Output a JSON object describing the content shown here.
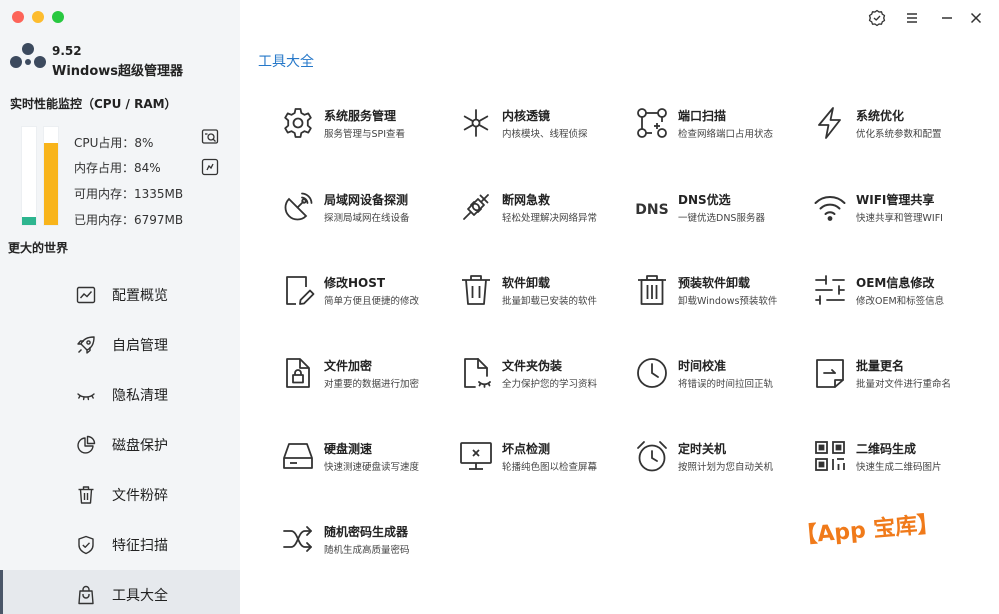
{
  "app": {
    "version": "9.52",
    "name": "Windows超级管理器",
    "slogan": "更大的世界"
  },
  "monitor": {
    "title": "实时性能监控（CPU / RAM）",
    "cpu_percent": 8,
    "mem_percent": 84,
    "stats": [
      "CPU占用：8%",
      "内存占用：84%",
      "可用内存：1335MB",
      "已用内存：6797MB"
    ],
    "colors": {
      "cpu": "#2db58f",
      "mem": "#f8b41b"
    }
  },
  "nav": [
    {
      "label": "配置概览",
      "icon": "chart-line-icon"
    },
    {
      "label": "自启管理",
      "icon": "rocket-icon"
    },
    {
      "label": "隐私清理",
      "icon": "eye-closed-icon"
    },
    {
      "label": "磁盘保护",
      "icon": "pie-chart-icon"
    },
    {
      "label": "文件粉碎",
      "icon": "trash-icon"
    },
    {
      "label": "特征扫描",
      "icon": "shield-check-icon"
    },
    {
      "label": "工具大全",
      "icon": "bag-icon",
      "active": true
    }
  ],
  "main": {
    "title": "工具大全",
    "accent": "#2678c9",
    "tools": [
      {
        "title": "系统服务管理",
        "desc": "服务管理与SPI查看",
        "icon": "gear-icon"
      },
      {
        "title": "内核透镜",
        "desc": "内核模块、线程侦探",
        "icon": "nodes-icon"
      },
      {
        "title": "端口扫描",
        "desc": "检查网络端口占用状态",
        "icon": "port-scan-icon"
      },
      {
        "title": "系统优化",
        "desc": "优化系统参数和配置",
        "icon": "lightning-icon"
      },
      {
        "title": "局域网设备探测",
        "desc": "探测局域网在线设备",
        "icon": "satellite-dish-icon"
      },
      {
        "title": "断网急救",
        "desc": "轻松处理解决网络异常",
        "icon": "plug-icon"
      },
      {
        "title": "DNS优选",
        "desc": "一键优选DNS服务器",
        "icon": "dns-icon",
        "icon_text": "DNS"
      },
      {
        "title": "WIFI管理共享",
        "desc": "快速共享和管理WIFI",
        "icon": "wifi-icon"
      },
      {
        "title": "修改HOST",
        "desc": "简单方便且便捷的修改",
        "icon": "file-edit-icon"
      },
      {
        "title": "软件卸载",
        "desc": "批量卸载已安装的软件",
        "icon": "trash-icon"
      },
      {
        "title": "预装软件卸载",
        "desc": "卸载Windows预装软件",
        "icon": "trash-box-icon"
      },
      {
        "title": "OEM信息修改",
        "desc": "修改OEM和标签信息",
        "icon": "sliders-icon"
      },
      {
        "title": "文件加密",
        "desc": "对重要的数据进行加密",
        "icon": "file-lock-icon"
      },
      {
        "title": "文件夹伪装",
        "desc": "全力保护您的学习资料",
        "icon": "file-disguise-icon"
      },
      {
        "title": "时间校准",
        "desc": "将错误的时间拉回正轨",
        "icon": "clock-icon"
      },
      {
        "title": "批量更名",
        "desc": "批量对文件进行重命名",
        "icon": "rename-icon"
      },
      {
        "title": "硬盘测速",
        "desc": "快速测速硬盘读写速度",
        "icon": "hard-drive-icon"
      },
      {
        "title": "坏点检测",
        "desc": "轮播纯色图以检查屏幕",
        "icon": "monitor-icon"
      },
      {
        "title": "定时关机",
        "desc": "按照计划为您自动关机",
        "icon": "alarm-clock-icon"
      },
      {
        "title": "二维码生成",
        "desc": "快速生成二维码图片",
        "icon": "qrcode-icon"
      },
      {
        "title": "随机密码生成器",
        "desc": "随机生成高质量密码",
        "icon": "shuffle-icon"
      }
    ]
  },
  "watermark": "【App 宝库】"
}
